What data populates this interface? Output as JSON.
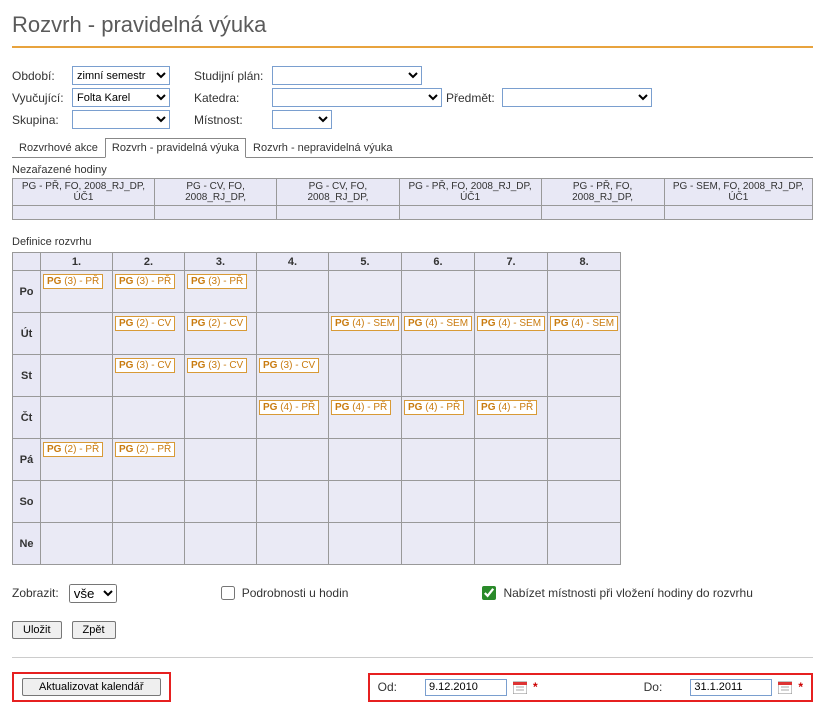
{
  "page_title": "Rozvrh - pravidelná výuka",
  "filters": {
    "period_label": "Období:",
    "period_value": "zimní semestr",
    "teacher_label": "Vyučující:",
    "teacher_value": "Folta Karel",
    "group_label": "Skupina:",
    "group_value": "",
    "plan_label": "Studijní plán:",
    "plan_value": "",
    "dept_label": "Katedra:",
    "dept_value": "",
    "subj_label": "Předmět:",
    "subj_value": "",
    "room_label": "Místnost:",
    "room_value": ""
  },
  "tabs": {
    "t1": "Rozvrhové akce",
    "t2": "Rozvrh - pravidelná výuka",
    "t3": "Rozvrh - nepravidelná výuka"
  },
  "unassigned": {
    "label": "Nezařazené hodiny",
    "headers": [
      "PG - PŘ, FO, 2008_RJ_DP, ÚČ1",
      "PG - CV, FO, 2008_RJ_DP,",
      "PG - CV, FO, 2008_RJ_DP,",
      "PG - PŘ, FO, 2008_RJ_DP, ÚČ1",
      "PG - PŘ, FO, 2008_RJ_DP,",
      "PG - SEM, FO, 2008_RJ_DP, ÚČ1"
    ]
  },
  "schedule": {
    "label": "Definice rozvrhu",
    "columns": [
      "1.",
      "2.",
      "3.",
      "4.",
      "5.",
      "6.",
      "7.",
      "8."
    ],
    "days": [
      "Po",
      "Út",
      "St",
      "Čt",
      "Pá",
      "So",
      "Ne"
    ],
    "cells": {
      "Po": {
        "1": "PG (3) - PŘ",
        "2": "PG (3) - PŘ",
        "3": "PG (3) - PŘ"
      },
      "Út": {
        "2": "PG (2) - CV",
        "3": "PG (2) - CV",
        "5": "PG (4) - SEM",
        "6": "PG (4) - SEM",
        "7": "PG (4) - SEM",
        "8": "PG (4) - SEM"
      },
      "St": {
        "2": "PG (3) - CV",
        "3": "PG (3) - CV",
        "4": "PG (3) - CV"
      },
      "Čt": {
        "4": "PG (4) - PŘ",
        "5": "PG (4) - PŘ",
        "6": "PG (4) - PŘ",
        "7": "PG (4) - PŘ"
      },
      "Pá": {
        "1": "PG (2) - PŘ",
        "2": "PG (2) - PŘ"
      },
      "So": {},
      "Ne": {}
    }
  },
  "display": {
    "show_label": "Zobrazit:",
    "show_value": "vše",
    "details_label": "Podrobnosti u hodin",
    "details_checked": false,
    "rooms_label": "Nabízet místnosti při vložení hodiny do rozvrhu",
    "rooms_checked": true
  },
  "buttons": {
    "save": "Uložit",
    "back": "Zpět",
    "update_cal": "Aktualizovat kalendář"
  },
  "dates": {
    "from_label": "Od:",
    "from_value": "9.12.2010",
    "to_label": "Do:",
    "to_value": "31.1.2011"
  }
}
